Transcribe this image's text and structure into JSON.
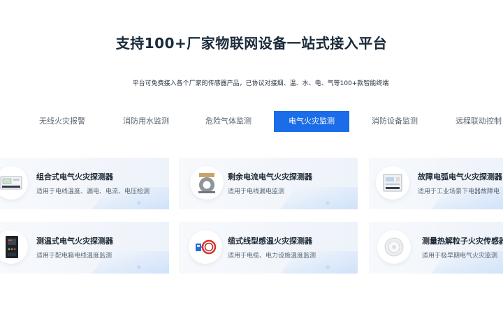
{
  "header": {
    "title": "支持100+厂家物联网设备一站式接入平台",
    "subtitle": "平台可免费接入各个厂家的传感器产品，已协议对接烟、温、水、电、气等100+款智能终端"
  },
  "tabs": [
    {
      "label": "无线火灾报警",
      "active": false
    },
    {
      "label": "消防用水监测",
      "active": false
    },
    {
      "label": "危险气体监测",
      "active": false
    },
    {
      "label": "电气火灾监测",
      "active": true
    },
    {
      "label": "消防设备监测",
      "active": false
    },
    {
      "label": "远程联动控制",
      "active": false
    }
  ],
  "colors": {
    "accent": "#1a6ce8",
    "card_bg": "#f3f6fb"
  },
  "products": [
    {
      "title": "组合式电气火灾探测器",
      "desc": "适用于电线温度、漏电、电流、电压检测",
      "icon": "combined-detector-icon"
    },
    {
      "title": "剩余电流电气火灾探测器",
      "desc": "适用于电线漏电监测",
      "icon": "residual-current-detector-icon"
    },
    {
      "title": "故障电弧电气火灾探测器",
      "desc": "适用于工业场景下电器故障电",
      "icon": "arc-fault-detector-icon"
    },
    {
      "title": "测温式电气火灾探测器",
      "desc": "适用于配电箱电线温度监测",
      "icon": "temperature-detector-icon"
    },
    {
      "title": "缆式线型感温火灾探测器",
      "desc": "适用于电缆、电力设施温度监测",
      "icon": "linear-heat-cable-icon"
    },
    {
      "title": "测量热解粒子火灾传感器",
      "desc": "适用于极早期电气火灾监测",
      "icon": "pyrolysis-particle-sensor-icon"
    }
  ]
}
